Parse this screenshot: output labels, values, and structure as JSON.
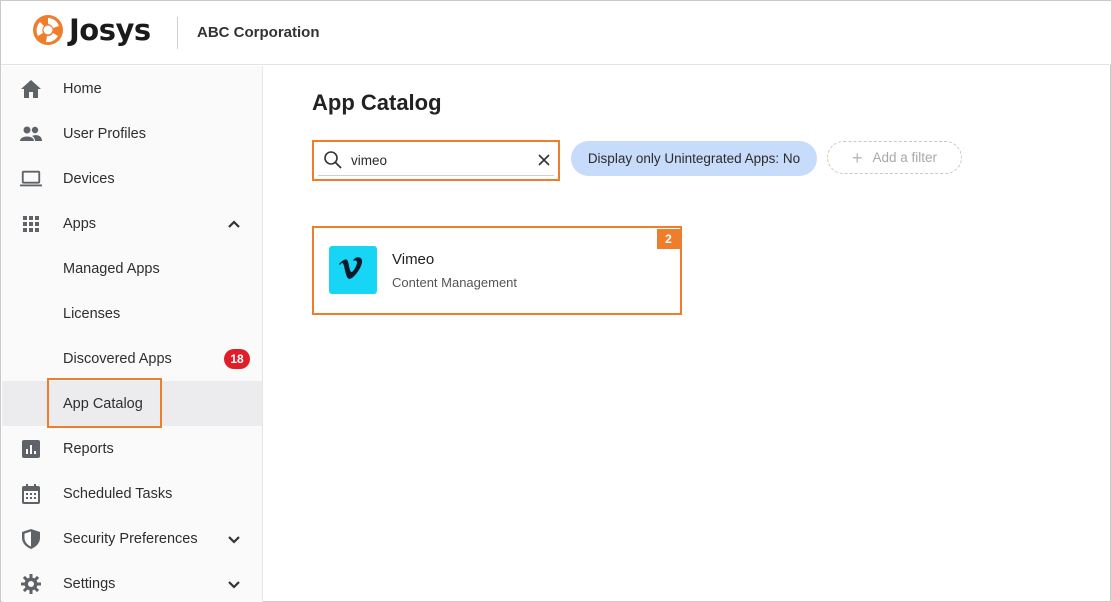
{
  "brand": {
    "name": "Josys",
    "company": "ABC Corporation",
    "accent_color": "#ee7d2c"
  },
  "sidebar": {
    "items": [
      {
        "label": "Home",
        "icon": "home-icon"
      },
      {
        "label": "User Profiles",
        "icon": "people-icon"
      },
      {
        "label": "Devices",
        "icon": "laptop-icon"
      },
      {
        "label": "Apps",
        "icon": "grid-icon",
        "expanded": true
      },
      {
        "label": "Managed Apps"
      },
      {
        "label": "Licenses"
      },
      {
        "label": "Discovered Apps",
        "badge": "18"
      },
      {
        "label": "App Catalog",
        "active": true
      },
      {
        "label": "Reports",
        "icon": "chart-icon"
      },
      {
        "label": "Scheduled Tasks",
        "icon": "calendar-icon"
      },
      {
        "label": "Security Preferences",
        "icon": "shield-icon",
        "expanded": false
      },
      {
        "label": "Settings",
        "icon": "gear-icon",
        "expanded": false
      }
    ]
  },
  "main": {
    "title": "App Catalog",
    "search": {
      "value": "vimeo"
    },
    "filter_chip": "Display only Unintegrated Apps: No",
    "add_filter": "Add a filter",
    "results": [
      {
        "name": "Vimeo",
        "category": "Content Management",
        "icon": "vimeo-logo-icon",
        "step": "2"
      }
    ]
  }
}
